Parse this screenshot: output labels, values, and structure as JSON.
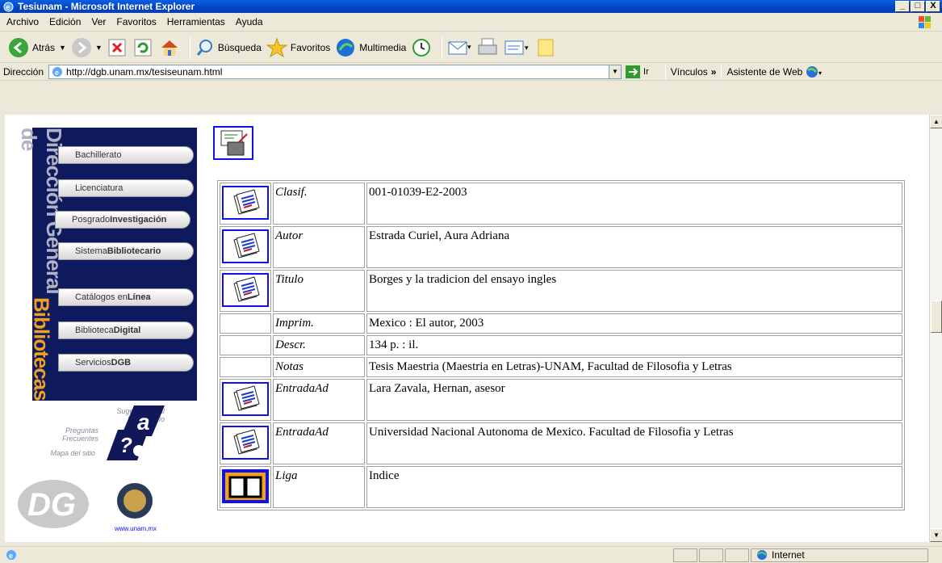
{
  "window": {
    "title": "Tesiunam - Microsoft Internet Explorer",
    "controls": [
      "_",
      "□",
      "X"
    ]
  },
  "menu": [
    "Archivo",
    "Edición",
    "Ver",
    "Favoritos",
    "Herramientas",
    "Ayuda"
  ],
  "toolbar": {
    "back": "Atrás",
    "search": "Búsqueda",
    "favorites": "Favoritos",
    "multimedia": "Multimedia"
  },
  "address": {
    "label": "Dirección",
    "url": "http://dgb.unam.mx/tesiseunam.html",
    "go": "Ir",
    "links": "Vínculos",
    "links_more": "»",
    "assistant": "Asistente de Web"
  },
  "sidebar": {
    "vertical_title_1": "Dirección General de ",
    "vertical_title_2": "Bibliotecas",
    "items": [
      {
        "prefix": "Bachillerato",
        "bold": ""
      },
      {
        "prefix": "Licenciatura",
        "bold": ""
      },
      {
        "prefix": "Posgrado",
        "bold": "Investigación"
      },
      {
        "prefix": "Sistema",
        "bold": "Bibliotecario"
      },
      {
        "prefix": "Catálogos en",
        "bold": "Línea"
      },
      {
        "prefix": "Biblioteca",
        "bold": "Digital"
      },
      {
        "prefix": "Servicios",
        "bold": "DGB"
      }
    ],
    "links": [
      "Sugerencias al Nuevo Sitio",
      "Preguntas Frecuentes",
      "Mapa del sitio"
    ],
    "unam_url": "www.unam.mx"
  },
  "record": [
    {
      "icon": "document",
      "label": "Clasif.",
      "value": "001-01039-E2-2003"
    },
    {
      "icon": "document",
      "label": "Autor",
      "value": "Estrada Curiel, Aura Adriana"
    },
    {
      "icon": "document",
      "label": "Titulo",
      "value": "Borges y la tradicion del ensayo ingles"
    },
    {
      "icon": "",
      "label": "Imprim.",
      "value": "Mexico : El autor, 2003"
    },
    {
      "icon": "",
      "label": "Descr.",
      "value": "134 p. : il."
    },
    {
      "icon": "",
      "label": "Notas",
      "value": "Tesis Maestria (Maestria en Letras)-UNAM, Facultad de Filosofia y Letras"
    },
    {
      "icon": "document",
      "label": "EntradaAd",
      "value": "Lara Zavala, Hernan, asesor"
    },
    {
      "icon": "document",
      "label": "EntradaAd",
      "value": "Universidad Nacional Autonoma de Mexico. Facultad de Filosofia y Letras"
    },
    {
      "icon": "book",
      "label": "Liga",
      "value": "Indice"
    }
  ],
  "status": {
    "zone": "Internet"
  }
}
